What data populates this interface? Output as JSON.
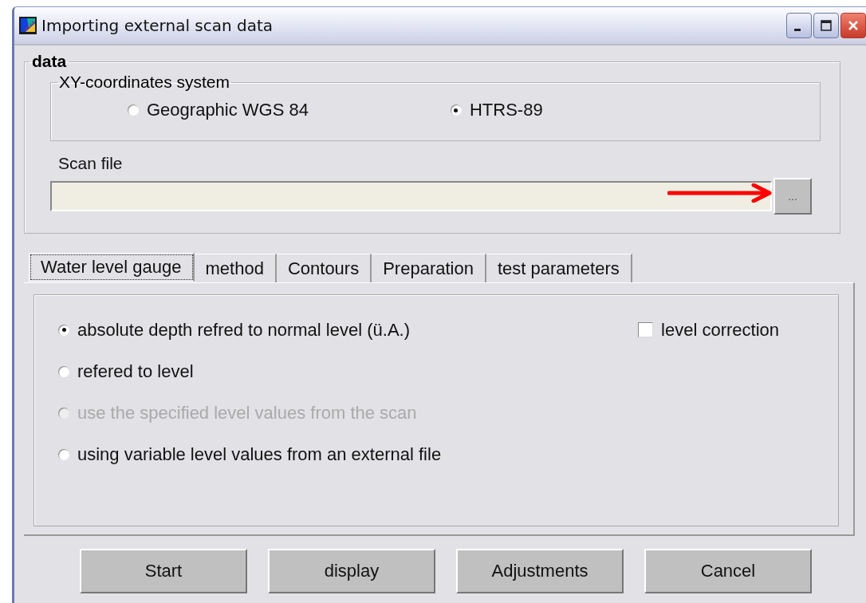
{
  "window": {
    "title": "Importing external scan data"
  },
  "data_group": {
    "legend": "data",
    "coordinates": {
      "legend": "XY-coordinates system",
      "options": [
        {
          "label": "Geographic WGS 84",
          "selected": false
        },
        {
          "label": "HTRS-89",
          "selected": true
        }
      ]
    },
    "scan_file": {
      "label": "Scan file",
      "browse_label": "..."
    }
  },
  "tabs": [
    {
      "label": "Water level gauge",
      "selected": true
    },
    {
      "label": "method",
      "selected": false
    },
    {
      "label": "Contours",
      "selected": false
    },
    {
      "label": "Preparation",
      "selected": false
    },
    {
      "label": "test parameters",
      "selected": false
    }
  ],
  "level_options": [
    {
      "label": "absolute depth refred to normal level (ü.A.)",
      "selected": true,
      "disabled": false
    },
    {
      "label": "refered to level",
      "selected": false,
      "disabled": false
    },
    {
      "label": "use the specified level values from the scan",
      "selected": false,
      "disabled": true
    },
    {
      "label": "using variable level values from an external file",
      "selected": false,
      "disabled": false
    }
  ],
  "level_correction": {
    "label": "level correction",
    "checked": false
  },
  "buttons": [
    "Start",
    "display",
    "Adjustments",
    "Cancel"
  ]
}
